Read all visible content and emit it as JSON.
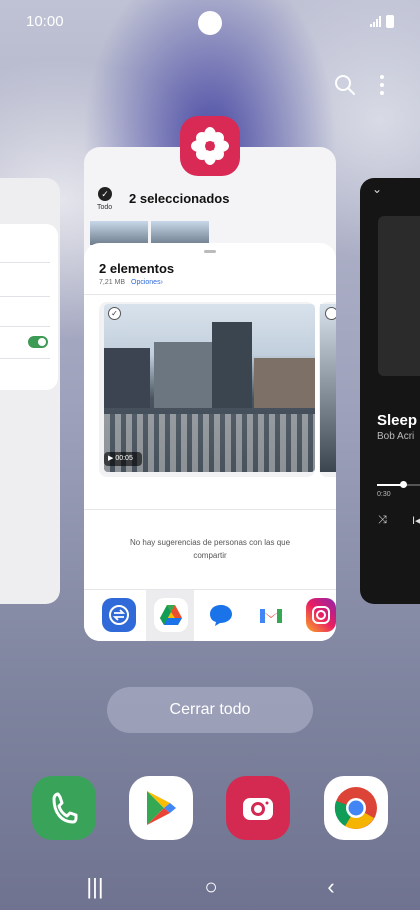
{
  "status_bar": {
    "time": "10:00"
  },
  "gallery_card": {
    "all_label": "Todo",
    "selected_label": "2 seleccionados"
  },
  "share_sheet": {
    "title": "2 elementos",
    "size": "7,21 MB",
    "options_label": "Opciones",
    "options_chevron": "›",
    "video_duration": "00:05",
    "no_people_text": "No hay sugerencias de personas con las que compartir",
    "apps": [
      {
        "icon": "quick-share-icon",
        "color": "#2f6ad8"
      },
      {
        "icon": "google-drive-icon",
        "color": "#34a853"
      },
      {
        "icon": "messages-icon",
        "color": "#1a73e8"
      },
      {
        "icon": "gmail-icon",
        "color": "#ea4335"
      },
      {
        "icon": "instagram-icon",
        "color": "#c13584"
      }
    ]
  },
  "music_card": {
    "title": "Sleep A",
    "artist": "Bob Acri",
    "elapsed": "0:30",
    "shuffle_icon": "⤨",
    "prev_icon": "I◀",
    "progress": 0.6
  },
  "actions": {
    "close_all_label": "Cerrar todo"
  },
  "dock": [
    {
      "icon": "phone-icon",
      "color": "#3aa35a"
    },
    {
      "icon": "play-store-icon",
      "color": "#ffffff"
    },
    {
      "icon": "camera-icon",
      "color": "#d42a52"
    },
    {
      "icon": "chrome-icon",
      "color": "#ffffff"
    }
  ],
  "nav": {
    "recents": "|||",
    "home": "○",
    "back": "‹"
  }
}
